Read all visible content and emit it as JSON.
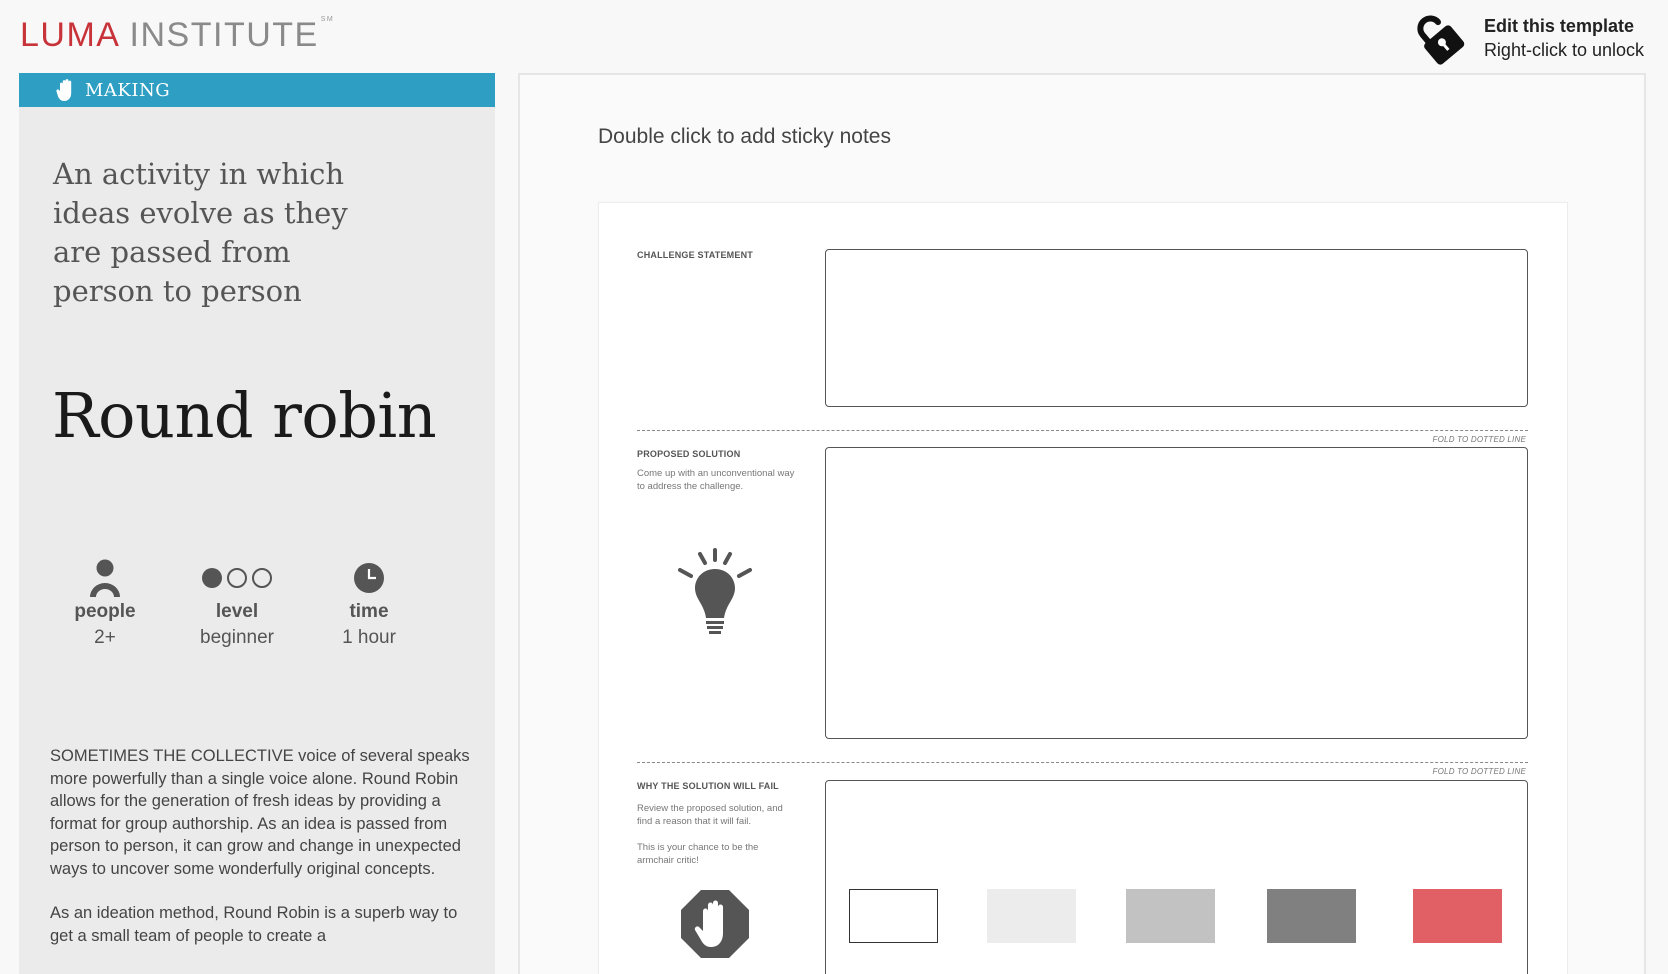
{
  "header": {
    "logo_luma": "LUMA",
    "logo_institute": "INSTITUTE",
    "logo_sm": "SM",
    "unlock_title": "Edit this template",
    "unlock_subtitle": "Right-click to unlock",
    "unlock_icon": "lock-icon"
  },
  "sidebar": {
    "category": "MAKING",
    "category_icon": "hand-icon",
    "category_color": "#2e9fc3",
    "tagline": "An activity in which ideas evolve as they are passed from person to person",
    "title": "Round robin",
    "stats": {
      "people_label": "people",
      "people_value": "2+",
      "level_label": "level",
      "level_value": "beginner",
      "level_filled": 1,
      "level_total": 3,
      "time_label": "time",
      "time_value": "1 hour"
    },
    "description": [
      "SOMETIMES THE COLLECTIVE voice of several speaks more powerfully than a single voice alone. Round Robin allows for the generation of fresh ideas by providing a format for group authorship. As an idea is passed from person to person, it can grow and change in unexpected ways to uncover some wonderfully original concepts.",
      "As an ideation method, Round Robin is a superb way to get a small team of people to create a"
    ]
  },
  "canvas": {
    "hint": "Double click to add sticky notes",
    "sections": {
      "challenge_title": "CHALLENGE STATEMENT",
      "proposed_title": "PROPOSED SOLUTION",
      "proposed_text": "Come up with an unconventional way to address the challenge.",
      "fail_title": "WHY THE SOLUTION WILL FAIL",
      "fail_text_1": "Review the proposed solution, and find a reason that it will fail.",
      "fail_text_2": "This is your chance to be the armchair critic!"
    },
    "fold_label": "FOLD TO DOTTED LINE",
    "icons": [
      "lightbulb-icon",
      "stop-hand-icon"
    ],
    "swatches": [
      "#ffffff",
      "#ececec",
      "#c2c2c2",
      "#808080",
      "#e06065"
    ]
  }
}
